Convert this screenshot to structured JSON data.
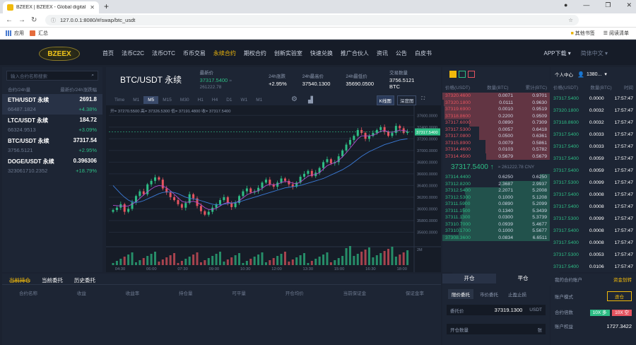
{
  "browser": {
    "tab_title": "BZEEX | BZEEX - Global digital",
    "url": "127.0.0.1:8080/#/swap/btc_usdt",
    "bookmarks": [
      "应用",
      "汇总"
    ],
    "bookmarks_right": [
      "其他书签",
      "阅读清单"
    ]
  },
  "nav": {
    "logo": "BZEEX",
    "items": [
      "首页",
      "法币C2C",
      "法币OTC",
      "币币交易",
      "永续合约",
      "期权合约",
      "创新实验室",
      "快速兑换",
      "推广合伙人",
      "资讯",
      "公告",
      "白皮书"
    ],
    "active": 4,
    "right": [
      "APP下载",
      "简体中文"
    ]
  },
  "markets": {
    "search_placeholder": "输入合约名称搜索",
    "head": [
      "合约/24h量",
      "最新价/24h涨跌幅"
    ],
    "rows": [
      {
        "name": "ETH/USDT 永续",
        "price": "2691.8",
        "vol": "66487.1824",
        "chg": "+4.38%"
      },
      {
        "name": "LTC/USDT 永续",
        "price": "184.72",
        "vol": "66324.9513",
        "chg": "+3.09%"
      },
      {
        "name": "BTC/USDT 永续",
        "price": "37317.54",
        "vol": "3756.5121",
        "chg": "+2.95%"
      },
      {
        "name": "DOGE/USDT 永续",
        "price": "0.396306",
        "vol": "323061710.2352",
        "chg": "+18.79%"
      }
    ]
  },
  "ticker": {
    "symbol": "BTC/USDT 永续",
    "last_label": "最新价",
    "last": "37317.5400",
    "last_cny": "≈ 261222.78",
    "chg_label": "24h涨跌",
    "chg": "+2.95%",
    "high_label": "24h最高价",
    "high": "37540.1300",
    "low_label": "24h最低价",
    "low": "35690.0500",
    "vol_label": "交易数量",
    "vol": "3756.5121 BTC"
  },
  "chart_toolbar": {
    "intervals": [
      "Time",
      "M1",
      "M5",
      "M15",
      "M30",
      "H1",
      "H4",
      "D1",
      "W1",
      "M1"
    ],
    "active": 2,
    "types": [
      "K线图",
      "深度图"
    ],
    "ohlc": "开= 37270.5500  高= 37326.5300  低= 37191.4800  收= 37317.5400"
  },
  "chart_data": {
    "type": "line",
    "ylim": [
      35400,
      37700
    ],
    "yticks": [
      "37600.0000",
      "37400.0000",
      "37200.0000",
      "37000.0000",
      "36800.0000",
      "36600.0000",
      "36400.0000",
      "36200.0000",
      "36000.0000",
      "35800.0000",
      "35600.0000"
    ],
    "xticks": [
      "04:30",
      "06:00",
      "07:30",
      "09:00",
      "10:30",
      "12:00",
      "13:30",
      "15:00",
      "16:30",
      "18:00"
    ],
    "current_price_label": "37317.5400",
    "volume_label": "2M",
    "series": [
      {
        "values": [
          35980,
          36020,
          36080,
          35950,
          36000,
          36110,
          36220,
          36300,
          36250,
          36420,
          36480,
          36540,
          36500,
          36350,
          36280,
          36200,
          36150,
          36080,
          36020,
          36100,
          36250,
          36180,
          36050,
          35960,
          35900,
          35950,
          36020,
          36080,
          36150,
          36200,
          36100,
          36030,
          36100,
          36220,
          36300,
          36350,
          36280,
          36300,
          36360,
          36450,
          36500,
          36420,
          36380,
          36450,
          36520,
          36480,
          36420,
          36380,
          36450,
          36550,
          36600,
          36650,
          36560,
          36620,
          36700,
          36800,
          36850,
          36780,
          36800,
          36900,
          37000,
          37100,
          37180,
          37250,
          37350,
          37300,
          37200,
          37250,
          37300,
          37350,
          37400,
          37320,
          37250,
          37300,
          37420,
          37380,
          37300,
          37320
        ]
      },
      {
        "values": [
          36060,
          36055,
          36050,
          36045,
          36050,
          36080,
          36120,
          36180,
          36240,
          36290,
          36340,
          36380,
          36400,
          36390,
          36360,
          36310,
          36250,
          36190,
          36130,
          36110,
          36120,
          36130,
          36110,
          36070,
          36020,
          35990,
          35990,
          36010,
          36050,
          36090,
          36110,
          36100,
          36100,
          36140,
          36190,
          36240,
          36270,
          36290,
          36310,
          36350,
          36400,
          36420,
          36410,
          36420,
          36450,
          36470,
          36460,
          36440,
          36430,
          36460,
          36510,
          36560,
          36580,
          36590,
          36620,
          36680,
          36740,
          36770,
          36790,
          36830,
          36890,
          36960,
          37040,
          37120,
          37200,
          37250,
          37250,
          37250,
          37260,
          37290,
          37330,
          37340,
          37320,
          37310,
          37330,
          37350,
          37340,
          37330
        ]
      },
      {
        "values": [
          36400,
          36330,
          36260,
          36200,
          36150,
          36120,
          36110,
          36120,
          36140,
          36170,
          36200,
          36230,
          36260,
          36280,
          36290,
          36290,
          36280,
          36260,
          36230,
          36200,
          36180,
          36170,
          36160,
          36140,
          36120,
          36100,
          36080,
          36070,
          36070,
          36080,
          36090,
          36100,
          36110,
          36120,
          36140,
          36160,
          36180,
          36200,
          36220,
          36240,
          36260,
          36280,
          36300,
          36320,
          36340,
          36360,
          36370,
          36380,
          36390,
          36400,
          36420,
          36440,
          36460,
          36480,
          36500,
          36520,
          36550,
          36580,
          36610,
          36640,
          36670,
          36710,
          36750,
          36800,
          36850,
          36900,
          36940,
          36980,
          37010,
          37040,
          37070,
          37100,
          37120,
          37140,
          37160,
          37180,
          37190,
          37200
        ]
      }
    ]
  },
  "orderbook": {
    "head": [
      "价格(USDT)",
      "数量(BTC)",
      "累计(BTC)"
    ],
    "asks": [
      {
        "p": "37320.4600",
        "q": "0.0071",
        "s": "0.9701",
        "d": 1.0
      },
      {
        "p": "37320.1800",
        "q": "0.0111",
        "s": "0.9630",
        "d": 0.99
      },
      {
        "p": "37319.6900",
        "q": "0.0010",
        "s": "0.9519",
        "d": 0.98
      },
      {
        "p": "37318.8600",
        "q": "0.2200",
        "s": "0.9509",
        "d": 0.98
      },
      {
        "p": "37317.6000",
        "q": "0.0890",
        "s": "0.7309",
        "d": 0.75
      },
      {
        "p": "37317.5300",
        "q": "0.0057",
        "s": "0.6418",
        "d": 0.66
      },
      {
        "p": "37317.0800",
        "q": "0.0500",
        "s": "0.6361",
        "d": 0.66
      },
      {
        "p": "37315.8900",
        "q": "0.0079",
        "s": "0.5861",
        "d": 0.6
      },
      {
        "p": "37314.4600",
        "q": "0.0103",
        "s": "0.5782",
        "d": 0.6
      },
      {
        "p": "37314.4500",
        "q": "0.5679",
        "s": "0.5679",
        "d": 0.59
      }
    ],
    "last": "37317.5400",
    "arrow": "↑",
    "last_cny": "≈ 261222.78 CNY",
    "bids": [
      {
        "p": "37314.4400",
        "q": "0.6250",
        "s": "0.6250",
        "d": 0.09
      },
      {
        "p": "37312.8200",
        "q": "2.3687",
        "s": "2.9937",
        "d": 0.46
      },
      {
        "p": "37312.5400",
        "q": "2.2071",
        "s": "5.2008",
        "d": 0.79
      },
      {
        "p": "37312.5300",
        "q": "0.1000",
        "s": "5.1208",
        "d": 0.78
      },
      {
        "p": "37311.5900",
        "q": "0.0890",
        "s": "5.2099",
        "d": 0.79
      },
      {
        "p": "37311.1500",
        "q": "0.1340",
        "s": "5.3439",
        "d": 0.81
      },
      {
        "p": "37311.1300",
        "q": "0.0300",
        "s": "5.3739",
        "d": 0.82
      },
      {
        "p": "37310.7000",
        "q": "0.0939",
        "s": "5.4677",
        "d": 0.83
      },
      {
        "p": "37310.1700",
        "q": "0.1000",
        "s": "5.5677",
        "d": 0.85
      },
      {
        "p": "37308.3600",
        "q": "0.0834",
        "s": "6.6511",
        "d": 1.0
      }
    ]
  },
  "trades": {
    "top_label": "个人中心",
    "head": [
      "价格(USDT)",
      "数量(BTC)",
      "时间"
    ],
    "user": "1380...",
    "rows": [
      {
        "p": "37317.5400",
        "q": "0.0000",
        "t": "17:57:47"
      },
      {
        "p": "37320.1800",
        "q": "0.0032",
        "t": "17:57:47"
      },
      {
        "p": "37318.8600",
        "q": "0.0032",
        "t": "17:57:47"
      },
      {
        "p": "37317.5400",
        "q": "0.0033",
        "t": "17:57:47"
      },
      {
        "p": "37317.5400",
        "q": "0.0033",
        "t": "17:57:47"
      },
      {
        "p": "37317.5400",
        "q": "0.0059",
        "t": "17:57:47"
      },
      {
        "p": "37317.5400",
        "q": "0.0059",
        "t": "17:57:47"
      },
      {
        "p": "37317.5300",
        "q": "0.0099",
        "t": "17:57:47"
      },
      {
        "p": "37317.5400",
        "q": "0.0008",
        "t": "17:57:47"
      },
      {
        "p": "37317.5400",
        "q": "0.0008",
        "t": "17:57:47"
      },
      {
        "p": "37317.5300",
        "q": "0.0099",
        "t": "17:57:47"
      },
      {
        "p": "37317.5400",
        "q": "0.0008",
        "t": "17:57:47"
      },
      {
        "p": "37317.5400",
        "q": "0.0008",
        "t": "17:57:47"
      },
      {
        "p": "37317.5300",
        "q": "0.0053",
        "t": "17:57:47"
      },
      {
        "p": "37317.5400",
        "q": "0.0106",
        "t": "17:57:47"
      }
    ]
  },
  "positions": {
    "tabs": [
      "当前持仓",
      "当前委托",
      "历史委托"
    ],
    "cols": [
      "合约名称",
      "收益",
      "收益率",
      "持仓量",
      "可平量",
      "开仓均价",
      "当前保证金",
      "保证金率"
    ]
  },
  "order": {
    "tabs": [
      "开仓",
      "平仓"
    ],
    "types": [
      "限价委托",
      "市价委托",
      "止盈止损"
    ],
    "price_label": "委托价",
    "price": "37319.1300",
    "price_unit": "USDT",
    "qty_label": "开仓数量",
    "qty_unit": "张"
  },
  "account": {
    "title": "我的合约账户",
    "transfer": "资金划转",
    "mode_label": "账户模式",
    "mode": "逐仓",
    "lev_label": "合约倍数",
    "long": "10X 多",
    "short": "10X 空",
    "equity_label": "账户权益",
    "equity": "1727.3422"
  }
}
